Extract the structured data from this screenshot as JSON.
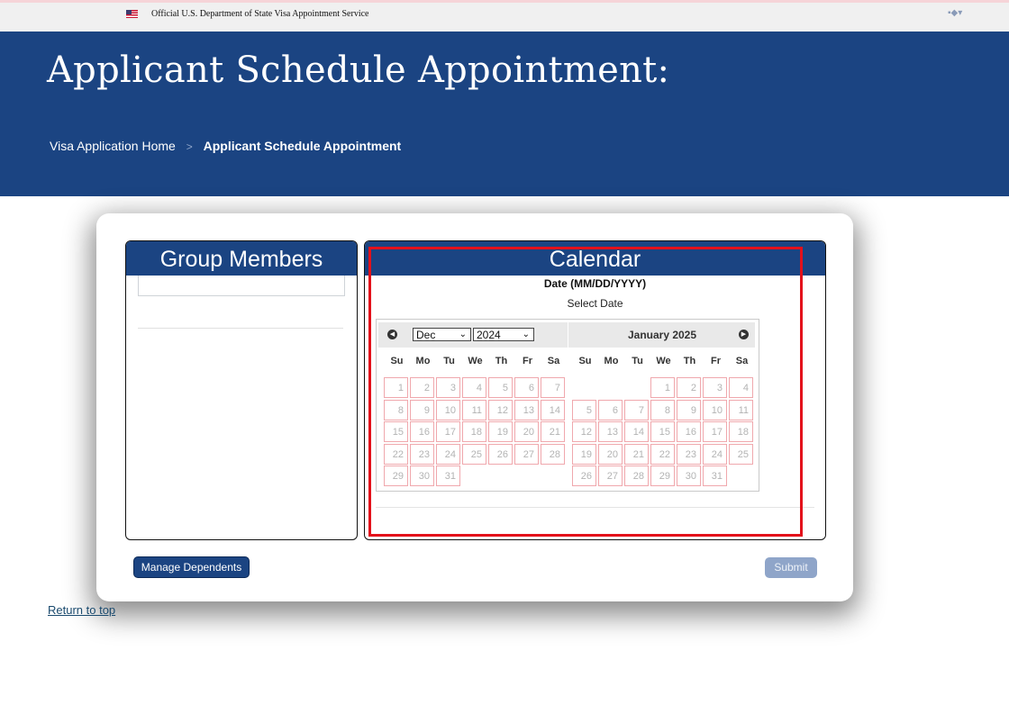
{
  "topbar": {
    "title": "Official U.S. Department of State Visa Appointment Service",
    "flag_icon": "us-flag-icon",
    "lang_icon": "globe-dropdown-icon"
  },
  "hero": {
    "title": "Applicant Schedule Appointment:",
    "breadcrumb": {
      "home": "Visa Application Home",
      "separator": ">",
      "current": "Applicant Schedule Appointment"
    }
  },
  "members_panel": {
    "title": "Group Members"
  },
  "calendar_panel": {
    "title": "Calendar",
    "date_label": "Date (MM/DD/YYYY)",
    "select_date": "Select Date",
    "datepicker": {
      "prev_icon": "◀",
      "next_icon": "▶",
      "month_select": "Dec",
      "year_select": "2024",
      "right_month_title": "January 2025",
      "weekdays": [
        "Su",
        "Mo",
        "Tu",
        "We",
        "Th",
        "Fr",
        "Sa"
      ],
      "left_weeks": [
        [
          "1",
          "2",
          "3",
          "4",
          "5",
          "6",
          "7"
        ],
        [
          "8",
          "9",
          "10",
          "11",
          "12",
          "13",
          "14"
        ],
        [
          "15",
          "16",
          "17",
          "18",
          "19",
          "20",
          "21"
        ],
        [
          "22",
          "23",
          "24",
          "25",
          "26",
          "27",
          "28"
        ],
        [
          "29",
          "30",
          "31",
          "",
          "",
          "",
          ""
        ]
      ],
      "right_weeks": [
        [
          "",
          "",
          "",
          "1",
          "2",
          "3",
          "4"
        ],
        [
          "5",
          "6",
          "7",
          "8",
          "9",
          "10",
          "11"
        ],
        [
          "12",
          "13",
          "14",
          "15",
          "16",
          "17",
          "18"
        ],
        [
          "19",
          "20",
          "21",
          "22",
          "23",
          "24",
          "25"
        ],
        [
          "26",
          "27",
          "28",
          "29",
          "30",
          "31",
          ""
        ]
      ]
    }
  },
  "buttons": {
    "manage_dependents": "Manage Dependents",
    "submit": "Submit"
  },
  "footer": {
    "return_to_top": "Return to top"
  },
  "colors": {
    "brand_blue": "#1b4482",
    "submit_disabled": "#8fa5c9",
    "highlight_red": "#e3111b",
    "day_border": "#f0a8ad"
  }
}
